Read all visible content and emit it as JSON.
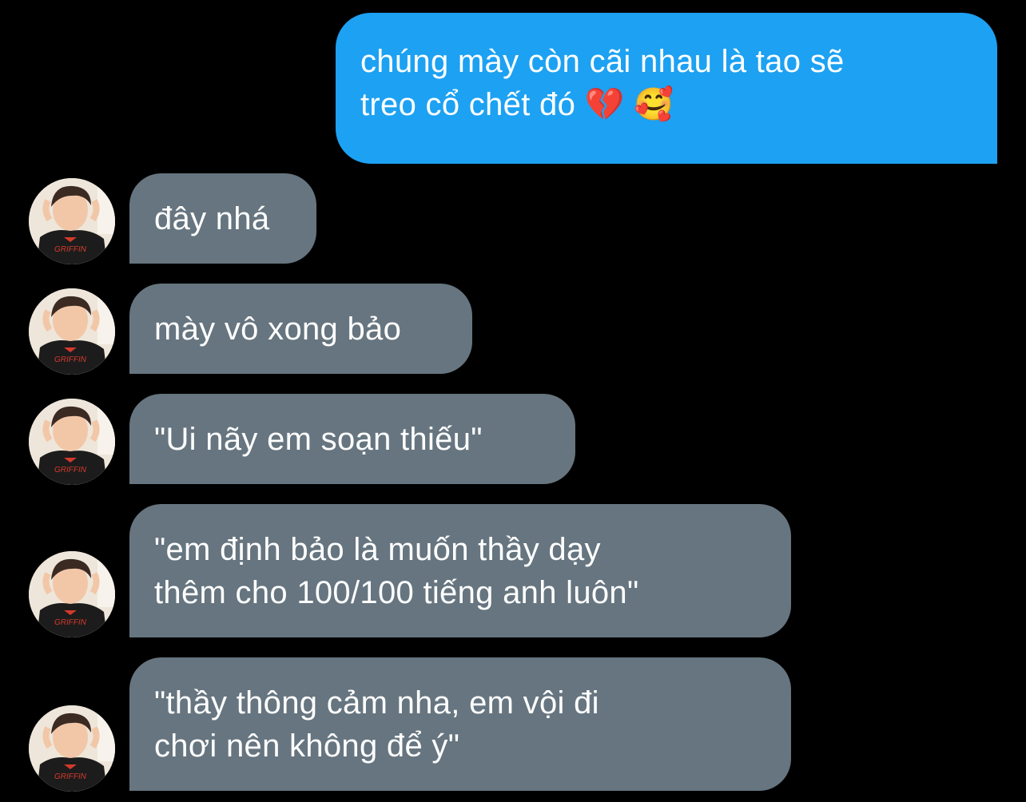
{
  "colors": {
    "background": "#000000",
    "sent_bubble": "#1da1f2",
    "received_bubble": "#66757f",
    "text": "#ffffff"
  },
  "conversation": {
    "sent": [
      {
        "text": "chúng mày còn cãi nhau là tao sẽ\ntreo cổ chết đó 💔 🥰"
      }
    ],
    "received": [
      {
        "text": "đây nhá",
        "avatar_text": "GRIFFIN"
      },
      {
        "text": "mày vô xong bảo",
        "avatar_text": "GRIFFIN"
      },
      {
        "text": "\"Ui nãy em soạn thiếu\"",
        "avatar_text": "GRIFFIN"
      },
      {
        "text": "\"em định bảo là muốn thầy dạy\nthêm cho 100/100 tiếng anh luôn\"",
        "avatar_text": "GRIFFIN"
      },
      {
        "text": "\"thầy thông cảm nha, em vội đi\nchơi nên không để ý\"",
        "avatar_text": "GRIFFIN"
      }
    ]
  }
}
